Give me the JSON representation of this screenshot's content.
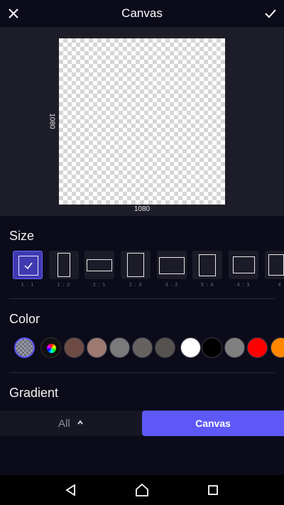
{
  "header": {
    "title": "Canvas",
    "close_icon": "close-icon",
    "confirm_icon": "check-icon"
  },
  "preview": {
    "width_label": "1080",
    "height_label": "1080"
  },
  "size_section": {
    "title": "Size",
    "ratios": [
      {
        "label": "1 : 1",
        "selected": true
      },
      {
        "label": "1 : 2"
      },
      {
        "label": "2 : 1"
      },
      {
        "label": "2 : 3"
      },
      {
        "label": "3 : 2"
      },
      {
        "label": "3 : 4"
      },
      {
        "label": "4 : 3"
      },
      {
        "label": "4"
      }
    ]
  },
  "color_section": {
    "title": "Color",
    "swatches": [
      "transparent",
      "color-wheel",
      "#6d4b44",
      "#9c7a70",
      "#7a7a7a",
      "#66625f",
      "#56524f",
      "#ffffff",
      "#000000",
      "#808080",
      "#ff0000",
      "#ff8800"
    ]
  },
  "gradient_section": {
    "title": "Gradient"
  },
  "bottom_tabs": {
    "all_label": "All",
    "canvas_label": "Canvas"
  },
  "colors": {
    "accent": "#5d58f6",
    "background": "#0b0b1a",
    "preview_bg": "#1c1d28"
  }
}
